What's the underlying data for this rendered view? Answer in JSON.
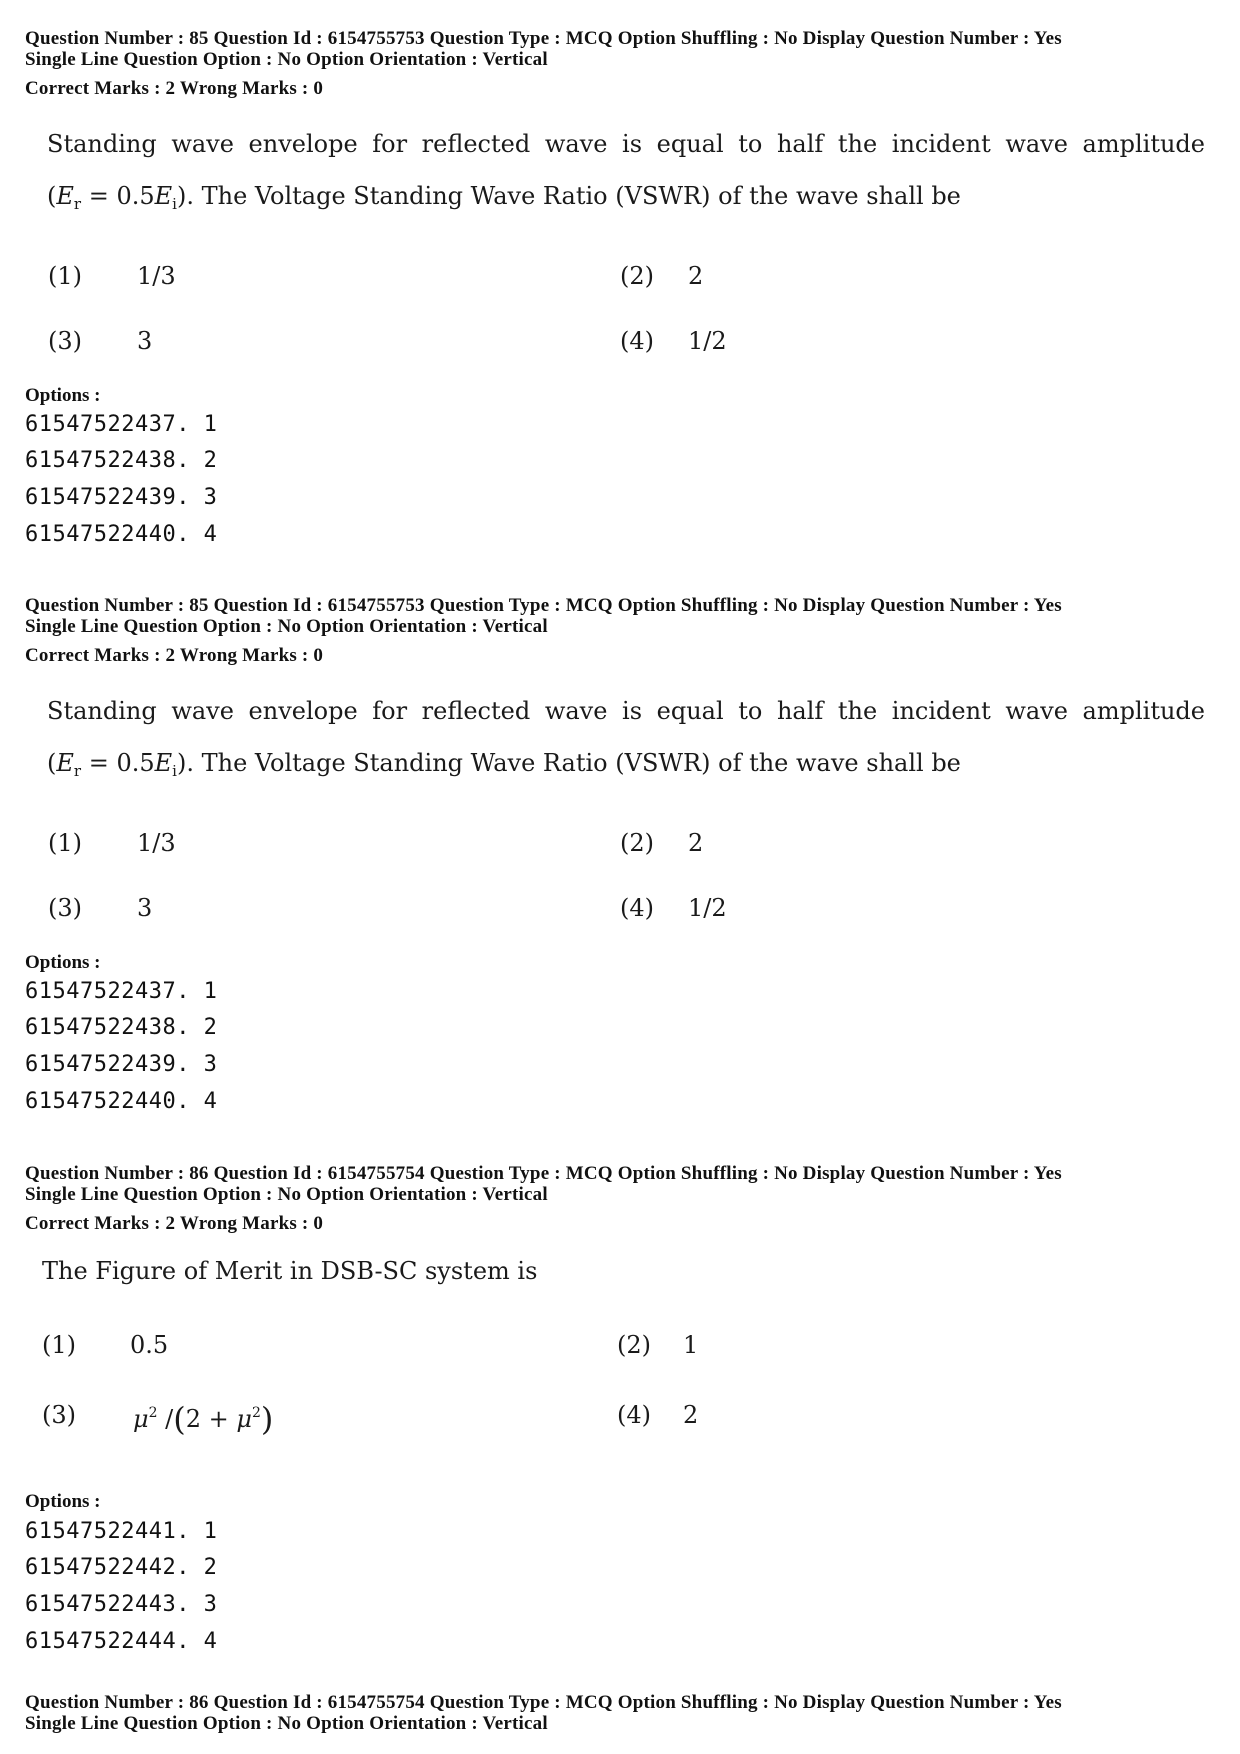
{
  "questions": [
    {
      "meta_line1": "Question Number : 85  Question Id : 6154755753  Question Type : MCQ  Option Shuffling : No  Display Question Number : Yes",
      "meta_line2": "Single Line Question Option : No  Option Orientation : Vertical",
      "marks": "Correct Marks : 2  Wrong Marks : 0",
      "stem_line1": "Standing wave envelope for reflected wave is equal to half the incident wave amplitude",
      "stem_line2_math": {
        "open": "(",
        "lhs": "E",
        "lhs_sub": "r",
        "eq": " = 0.5",
        "rhs": "E",
        "rhs_sub": "i",
        "close": ")"
      },
      "stem_line2_text": ". The Voltage Standing Wave Ratio (VSWR) of the wave shall be",
      "choices": [
        {
          "num": "(1)",
          "value": "1/3"
        },
        {
          "num": "(2)",
          "value": "2"
        },
        {
          "num": "(3)",
          "value": "3"
        },
        {
          "num": "(4)",
          "value": "1/2"
        }
      ],
      "options_label": "Options :",
      "option_ids": [
        "61547522437. 1",
        "61547522438. 2",
        "61547522439. 3",
        "61547522440. 4"
      ]
    },
    {
      "meta_line1": "Question Number : 85  Question Id : 6154755753  Question Type : MCQ  Option Shuffling : No  Display Question Number : Yes",
      "meta_line2": "Single Line Question Option : No  Option Orientation : Vertical",
      "marks": "Correct Marks : 2  Wrong Marks : 0",
      "stem_line1": "Standing wave envelope for reflected wave is equal to half the incident wave amplitude",
      "stem_line2_math": {
        "open": "(",
        "lhs": "E",
        "lhs_sub": "r",
        "eq": " = 0.5",
        "rhs": "E",
        "rhs_sub": "i",
        "close": ")"
      },
      "stem_line2_text": ". The Voltage Standing Wave Ratio (VSWR) of the wave shall be",
      "choices": [
        {
          "num": "(1)",
          "value": "1/3"
        },
        {
          "num": "(2)",
          "value": "2"
        },
        {
          "num": "(3)",
          "value": "3"
        },
        {
          "num": "(4)",
          "value": "1/2"
        }
      ],
      "options_label": "Options :",
      "option_ids": [
        "61547522437. 1",
        "61547522438. 2",
        "61547522439. 3",
        "61547522440. 4"
      ]
    },
    {
      "meta_line1": "Question Number : 86  Question Id : 6154755754  Question Type : MCQ  Option Shuffling : No  Display Question Number : Yes",
      "meta_line2": "Single Line Question Option : No  Option Orientation : Vertical",
      "marks": "Correct Marks : 2  Wrong Marks : 0",
      "stem_line1": "The Figure of Merit in DSB-SC system is",
      "choices": [
        {
          "num": "(1)",
          "value": "0.5"
        },
        {
          "num": "(2)",
          "value": "1"
        },
        {
          "num": "(3)",
          "value_math": {
            "mu": "μ",
            "exp": "2",
            "slash": " /",
            "open": "(",
            "two_plus": "2 + ",
            "mu2": "μ",
            "exp2": "2",
            "close": ")"
          }
        },
        {
          "num": "(4)",
          "value": "2"
        }
      ],
      "options_label": "Options :",
      "option_ids": [
        "61547522441. 1",
        "61547522442. 2",
        "61547522443. 3",
        "61547522444. 4"
      ]
    },
    {
      "meta_line1": "Question Number : 86  Question Id : 6154755754  Question Type : MCQ  Option Shuffling : No  Display Question Number : Yes",
      "meta_line2": "Single Line Question Option : No  Option Orientation : Vertical"
    }
  ]
}
